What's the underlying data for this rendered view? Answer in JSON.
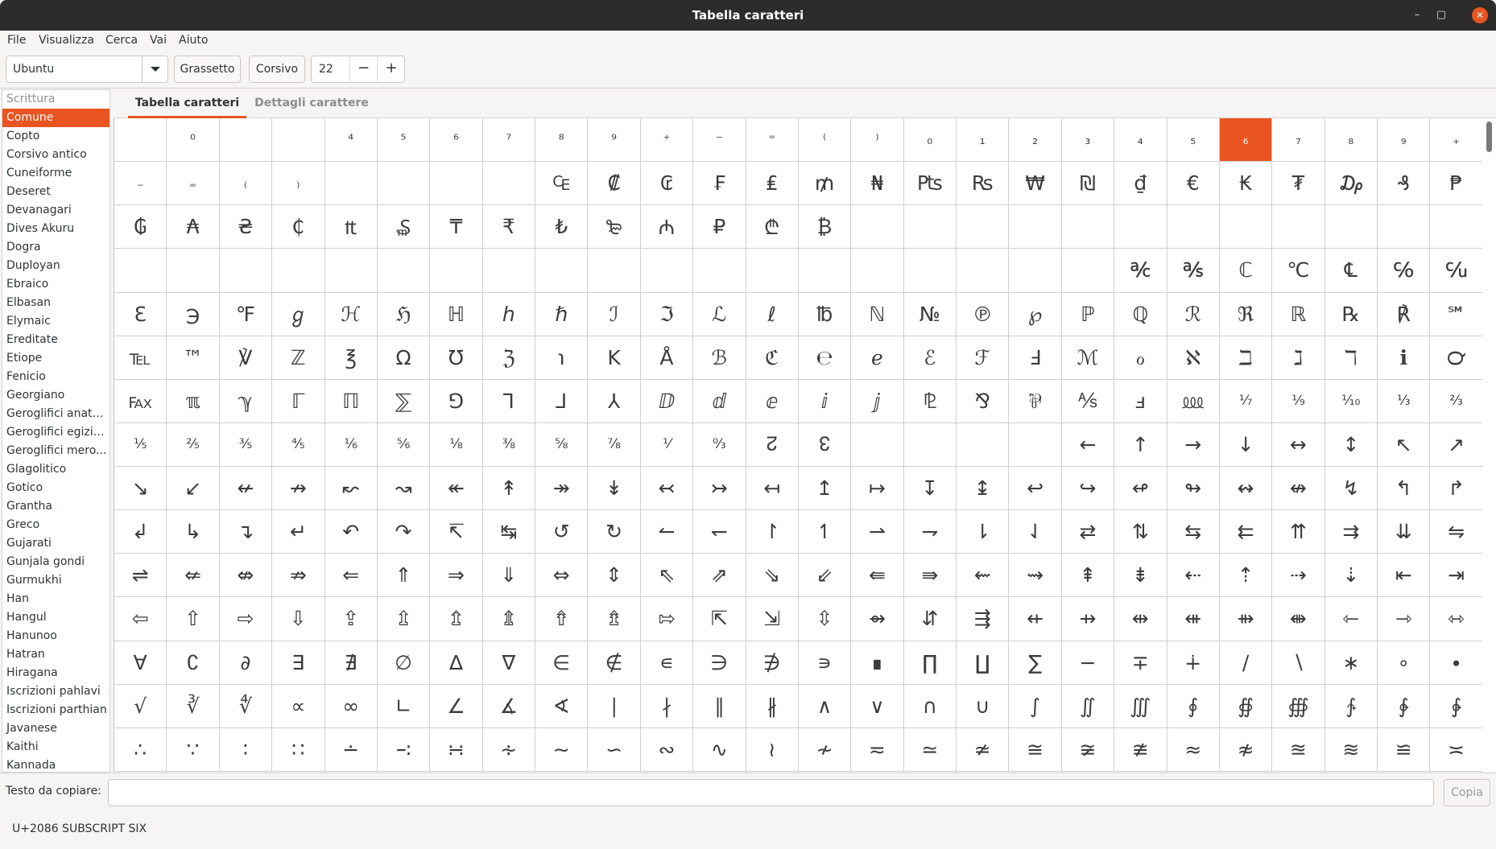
{
  "window": {
    "title": "Tabella caratteri"
  },
  "menu": [
    "File",
    "Visualizza",
    "Cerca",
    "Vai",
    "Aiuto"
  ],
  "toolbar": {
    "font": "Ubuntu",
    "bold_label": "Grassetto",
    "italic_label": "Corsivo",
    "size": "22"
  },
  "sidebar": {
    "header": "Scrittura",
    "items": [
      "Comune",
      "Copto",
      "Corsivo antico",
      "Cuneiforme",
      "Deseret",
      "Devanagari",
      "Dives Akuru",
      "Dogra",
      "Duployan",
      "Ebraico",
      "Elbasan",
      "Elymaic",
      "Ereditate",
      "Etiope",
      "Fenicio",
      "Georgiano",
      "Geroglifici anato...",
      "Geroglifici egiziani",
      "Geroglifici mero...",
      "Glagolitico",
      "Gotico",
      "Grantha",
      "Greco",
      "Gujarati",
      "Gunjala gondi",
      "Gurmukhi",
      "Han",
      "Hangul",
      "Hanunoo",
      "Hatran",
      "Hiragana",
      "Iscrizioni pahlavi",
      "Iscrizioni parthian",
      "Javanese",
      "Kaithi",
      "Kannada"
    ],
    "selected": "Comune"
  },
  "tabs": [
    "Tabella caratteri",
    "Dettagli carattere"
  ],
  "active_tab": "Tabella caratteri",
  "chars": [
    "",
    "⁰",
    "",
    "",
    "⁴",
    "⁵",
    "⁶",
    "⁷",
    "⁸",
    "⁹",
    "⁺",
    "⁻",
    "⁼",
    "⁽",
    "⁾",
    "₀",
    "₁",
    "₂",
    "₃",
    "₄",
    "₅",
    "₆",
    "₇",
    "₈",
    "₉",
    "₊",
    "₋",
    "₌",
    "₍",
    "₎",
    "",
    "",
    "",
    "",
    "₠",
    "₡",
    "₢",
    "₣",
    "₤",
    "₥",
    "₦",
    "₧",
    "₨",
    "₩",
    "₪",
    "₫",
    "€",
    "₭",
    "₮",
    "₯",
    "₰",
    "₱",
    "₲",
    "₳",
    "₴",
    "₵",
    "₶",
    "₷",
    "₸",
    "₹",
    "₺",
    "₻",
    "₼",
    "₽",
    "₾",
    "₿",
    "",
    "",
    "",
    "",
    "",
    "",
    "",
    "",
    "",
    "",
    "",
    "",
    "",
    "",
    "",
    "",
    "",
    "",
    "",
    "",
    "",
    "",
    "",
    "",
    "",
    "",
    "",
    "",
    "",
    "",
    "",
    "℀",
    "℁",
    "ℂ",
    "℃",
    "℄",
    "℅",
    "℆",
    "ℇ",
    "℈",
    "℉",
    "ℊ",
    "ℋ",
    "ℌ",
    "ℍ",
    "ℎ",
    "ℏ",
    "ℐ",
    "ℑ",
    "ℒ",
    "ℓ",
    "℔",
    "ℕ",
    "№",
    "℗",
    "℘",
    "ℙ",
    "ℚ",
    "ℛ",
    "ℜ",
    "ℝ",
    "℞",
    "℟",
    "℠",
    "℡",
    "™",
    "℣",
    "ℤ",
    "℥",
    "Ω",
    "℧",
    "ℨ",
    "℩",
    "K",
    "Å",
    "ℬ",
    "ℭ",
    "℮",
    "ℯ",
    "ℰ",
    "ℱ",
    "Ⅎ",
    "ℳ",
    "ℴ",
    "ℵ",
    "ℶ",
    "ℷ",
    "ℸ",
    "ℹ",
    "℺",
    "℻",
    "ℼ",
    "ℽ",
    "ℾ",
    "ℿ",
    "⅀",
    "⅁",
    "⅂",
    "⅃",
    "⅄",
    "ⅅ",
    "ⅆ",
    "ⅇ",
    "ⅈ",
    "ⅉ",
    "⅊",
    "⅋",
    "⅌",
    "⅍",
    "ⅎ",
    "⅏",
    "⅐",
    "⅑",
    "⅒",
    "⅓",
    "⅔",
    "⅕",
    "⅖",
    "⅗",
    "⅘",
    "⅙",
    "⅚",
    "⅛",
    "⅜",
    "⅝",
    "⅞",
    "⅟",
    "↉",
    "↊",
    "↋",
    "",
    "",
    "",
    "",
    "←",
    "↑",
    "→",
    "↓",
    "↔",
    "↕",
    "↖",
    "↗",
    "↘",
    "↙",
    "↚",
    "↛",
    "↜",
    "↝",
    "↞",
    "↟",
    "↠",
    "↡",
    "↢",
    "↣",
    "↤",
    "↥",
    "↦",
    "↧",
    "↨",
    "↩",
    "↪",
    "↫",
    "↬",
    "↭",
    "↮",
    "↯",
    "↰",
    "↱",
    "↲",
    "↳",
    "↴",
    "↵",
    "↶",
    "↷",
    "↸",
    "↹",
    "↺",
    "↻",
    "↼",
    "↽",
    "↾",
    "↿",
    "⇀",
    "⇁",
    "⇂",
    "⇃",
    "⇄",
    "⇅",
    "⇆",
    "⇇",
    "⇈",
    "⇉",
    "⇊",
    "⇋",
    "⇌",
    "⇍",
    "⇎",
    "⇏",
    "⇐",
    "⇑",
    "⇒",
    "⇓",
    "⇔",
    "⇕",
    "⇖",
    "⇗",
    "⇘",
    "⇙",
    "⇚",
    "⇛",
    "⇜",
    "⇝",
    "⇞",
    "⇟",
    "⇠",
    "⇡",
    "⇢",
    "⇣",
    "⇤",
    "⇥",
    "⇦",
    "⇧",
    "⇨",
    "⇩",
    "⇪",
    "⇫",
    "⇬",
    "⇭",
    "⇮",
    "⇯",
    "⇰",
    "⇱",
    "⇲",
    "⇳",
    "⇴",
    "⇵",
    "⇶",
    "⇷",
    "⇸",
    "⇹",
    "⇺",
    "⇻",
    "⇼",
    "⇽",
    "⇾",
    "⇿",
    "∀",
    "∁",
    "∂",
    "∃",
    "∄",
    "∅",
    "∆",
    "∇",
    "∈",
    "∉",
    "∊",
    "∋",
    "∌",
    "∍",
    "∎",
    "∏",
    "∐",
    "∑",
    "−",
    "∓",
    "∔",
    "∕",
    "∖",
    "∗",
    "∘",
    "∙",
    "√",
    "∛",
    "∜",
    "∝",
    "∞",
    "∟",
    "∠",
    "∡",
    "∢",
    "∣",
    "∤",
    "∥",
    "∦",
    "∧",
    "∨",
    "∩",
    "∪",
    "∫",
    "∬",
    "∭",
    "∮",
    "∯",
    "∰",
    "∱",
    "∲",
    "∳",
    "∴",
    "∵",
    "∶",
    "∷",
    "∸",
    "∹",
    "∺",
    "∻",
    "∼",
    "∽",
    "∾",
    "∿",
    "≀",
    "≁",
    "≂",
    "≃",
    "≄",
    "≅",
    "≆",
    "≇",
    "≈",
    "≉",
    "≊",
    "≋",
    "≌",
    "≍",
    "≎",
    "≏",
    "≐",
    "≑",
    "≒",
    "≓"
  ],
  "selected_char": "₆",
  "copy": {
    "label": "Testo da copiare:",
    "value": "",
    "button": "Copia"
  },
  "status": "U+2086 SUBSCRIPT SIX",
  "colors": {
    "accent": "#e95420",
    "titlebar": "#2c2c2c"
  }
}
